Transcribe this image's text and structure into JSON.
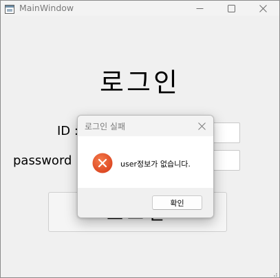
{
  "window": {
    "title": "MainWindow",
    "icons": {
      "app": "app-window-icon",
      "minimize": "minimize-icon",
      "maximize": "maximize-icon",
      "close": "close-icon"
    }
  },
  "login_form": {
    "heading": "로그인",
    "id_label": "ID :",
    "password_label": "password :",
    "id_value": "",
    "password_value": "",
    "submit_label": "로그인"
  },
  "dialog": {
    "title": "로그인 실패",
    "message": "user정보가 없습니다.",
    "ok_label": "확인",
    "icon": "error-icon",
    "error_color": "#e4502a"
  }
}
